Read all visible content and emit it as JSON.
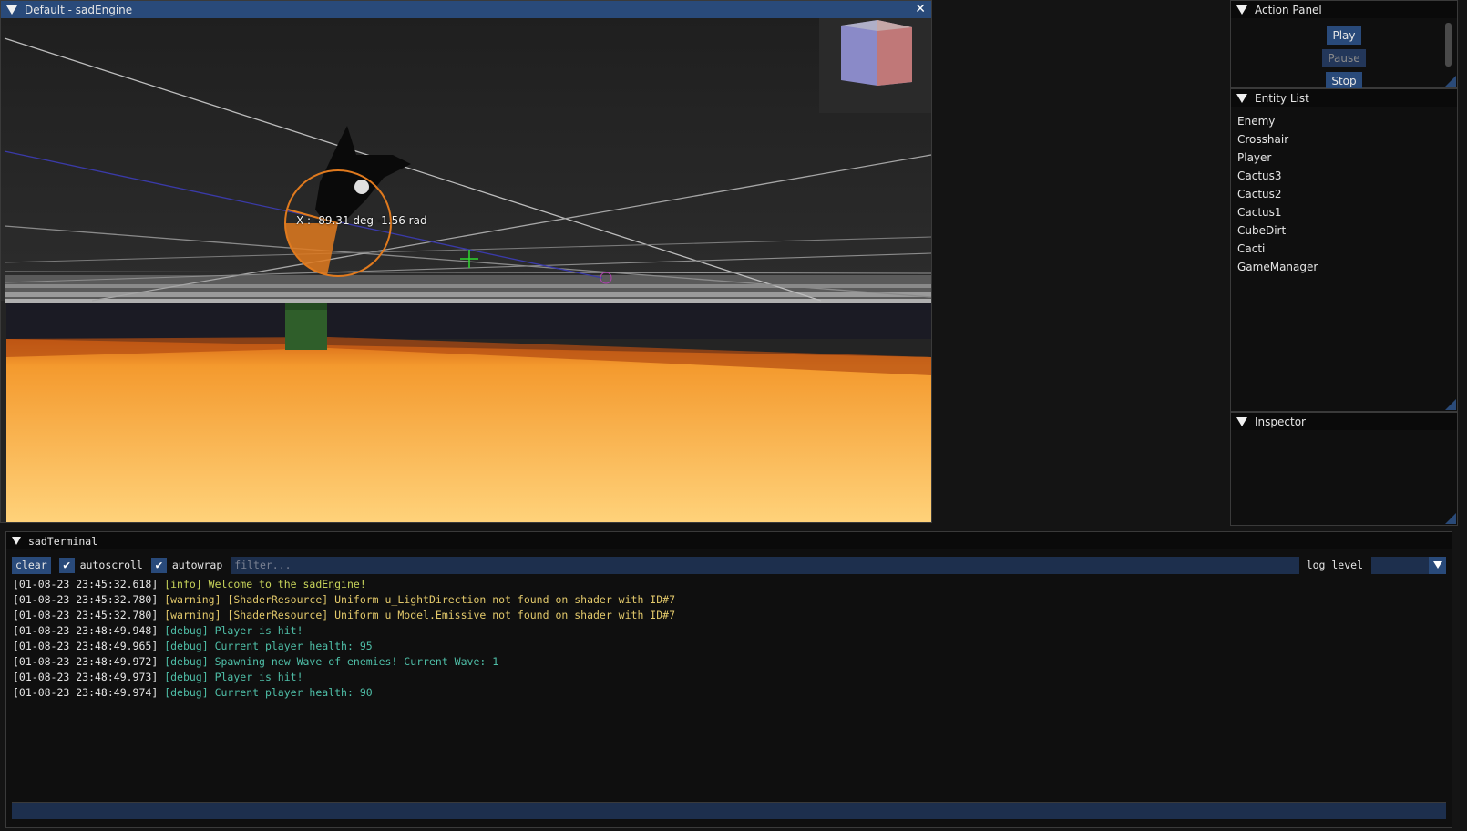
{
  "viewport": {
    "title": "Default - sadEngine",
    "gizmo_label": "X : -89.31 deg -1.56 rad"
  },
  "action_panel": {
    "title": "Action Panel",
    "play": "Play",
    "pause": "Pause",
    "stop": "Stop"
  },
  "entity_list": {
    "title": "Entity List",
    "items": [
      "Enemy",
      "Crosshair",
      "Player",
      "Cactus3",
      "Cactus2",
      "Cactus1",
      "CubeDirt",
      "Cacti",
      "GameManager"
    ]
  },
  "inspector": {
    "title": "Inspector"
  },
  "terminal": {
    "title": "sadTerminal",
    "clear": "clear",
    "autoscroll": "autoscroll",
    "autowrap": "autowrap",
    "filter_placeholder": "filter...",
    "log_level_label": "log level",
    "log_level_value": "",
    "lines": [
      {
        "ts": "[01-08-23 23:45:32.618]",
        "msg": "[info] Welcome to the sadEngine!"
      },
      {
        "ts": "[01-08-23 23:45:32.780]",
        "msg": "[warning] [ShaderResource] Uniform u_LightDirection not found on shader with ID#7"
      },
      {
        "ts": "[01-08-23 23:45:32.780]",
        "msg": "[warning] [ShaderResource] Uniform u_Model.Emissive not found on shader with ID#7"
      },
      {
        "ts": "[01-08-23 23:48:49.948]",
        "msg": "[debug] Player is hit!"
      },
      {
        "ts": "[01-08-23 23:48:49.965]",
        "msg": "[debug] Current player health: 95"
      },
      {
        "ts": "[01-08-23 23:48:49.972]",
        "msg": "[debug] Spawning new Wave of enemies! Current Wave: 1"
      },
      {
        "ts": "[01-08-23 23:48:49.973]",
        "msg": "[debug] Player is hit!"
      },
      {
        "ts": "[01-08-23 23:48:49.974]",
        "msg": "[debug] Current player health: 90"
      }
    ]
  },
  "colors": {
    "title_active": "#294a7a",
    "accent": "#294a7a",
    "info": "#c8d45a",
    "warning": "#e3c96b",
    "debug": "#4fbfa8",
    "gizmo": "#e07a1e"
  }
}
